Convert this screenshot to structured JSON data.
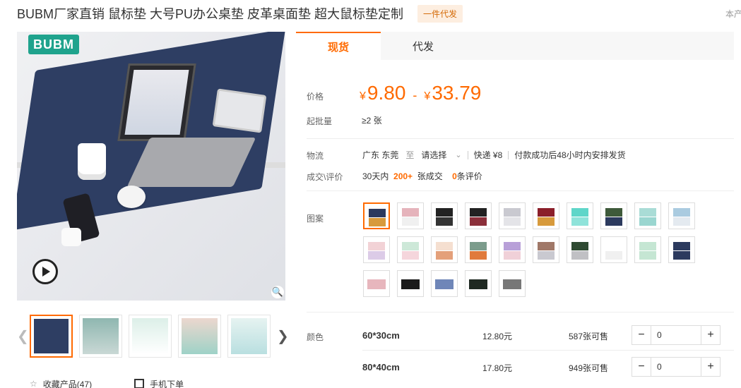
{
  "product": {
    "title": "BUBM厂家直销 鼠标垫 大号PU办公桌垫 皮革桌面垫 超大鼠标垫定制",
    "badge": "一件代发",
    "right_label": "本产"
  },
  "gallery": {
    "brand_logo_text": "BUBM",
    "play_icon": "play-icon",
    "zoom_icon": "zoom-icon",
    "thumbnails": [
      {
        "name": "thumb-1",
        "active": true
      },
      {
        "name": "thumb-2",
        "active": false
      },
      {
        "name": "thumb-3",
        "active": false
      },
      {
        "name": "thumb-4",
        "active": false
      },
      {
        "name": "thumb-5",
        "active": false
      }
    ],
    "favorite_label": "收藏产品(47)",
    "mobile_order_label": "手机下单"
  },
  "tabs": [
    {
      "label": "现货",
      "active": true
    },
    {
      "label": "代发",
      "active": false
    }
  ],
  "price": {
    "label": "价格",
    "currency": "¥",
    "low": "9.80",
    "dash": "-",
    "high": "33.79"
  },
  "moq": {
    "label": "起批量",
    "value": "≥2 张"
  },
  "logistics": {
    "label": "物流",
    "origin": "广东 东莞",
    "to": "至",
    "select": "请选择",
    "express": "快递 ¥8",
    "note": "付款成功后48小时内安排发货"
  },
  "deals": {
    "label": "成交\\评价",
    "days_text": "30天内",
    "count": "200+",
    "count_suffix": "张成交",
    "reviews": "0",
    "reviews_suffix": "条评价"
  },
  "pattern": {
    "label": "图案",
    "swatches": [
      {
        "top": "#2c3a5e",
        "bottom": "#d79a3c",
        "active": true
      },
      {
        "top": "#e5b3bb",
        "bottom": "#f0f0f0"
      },
      {
        "top": "#222222",
        "bottom": "#333333"
      },
      {
        "top": "#222222",
        "bottom": "#8b2f3a"
      },
      {
        "top": "#c9c9d0",
        "bottom": "#e4e4e8"
      },
      {
        "top": "#8b1f2a",
        "bottom": "#d79a3c"
      },
      {
        "top": "#5fd6c9",
        "bottom": "#8fe3da"
      },
      {
        "top": "#3e5a3a",
        "bottom": "#2c3a5e"
      },
      {
        "top": "#a9dcd6",
        "bottom": "#9ad6d0"
      },
      {
        "top": "#aacbe0",
        "bottom": "#e4eaf0"
      },
      {
        "top": "#f2d2d6",
        "bottom": "#dccbe7"
      },
      {
        "top": "#cde8d8",
        "bottom": "#f5d6dc"
      },
      {
        "top": "#f5dfd0",
        "bottom": "#e4a07a"
      },
      {
        "top": "#7c9c8c",
        "bottom": "#e07a3c"
      },
      {
        "top": "#b8a0d8",
        "bottom": "#f0d0d8"
      },
      {
        "top": "#a07868",
        "bottom": "#c9c9d0"
      },
      {
        "top": "#2f4a32",
        "bottom": "#c0c0c4"
      },
      {
        "top": "#ffffff",
        "bottom": "#f0f0f0"
      },
      {
        "top": "#c5e6d3",
        "bottom": "#c5e6d3"
      },
      {
        "top": "#2c3a5e",
        "bottom": "#2c3a5e"
      },
      {
        "single": "#e7b6bd"
      },
      {
        "single": "#1a1a1a"
      },
      {
        "single": "#6f86b8"
      },
      {
        "single": "#1f2a22"
      },
      {
        "single": "#777777"
      }
    ]
  },
  "colors": {
    "label": "颜色",
    "rows": [
      {
        "size": "60*30cm",
        "price": "12.80元",
        "stock": "587张可售",
        "qty": "0"
      },
      {
        "size": "80*40cm",
        "price": "17.80元",
        "stock": "949张可售",
        "qty": "0"
      }
    ],
    "minus": "−",
    "plus": "+"
  },
  "accent_color": "#ff6a00"
}
